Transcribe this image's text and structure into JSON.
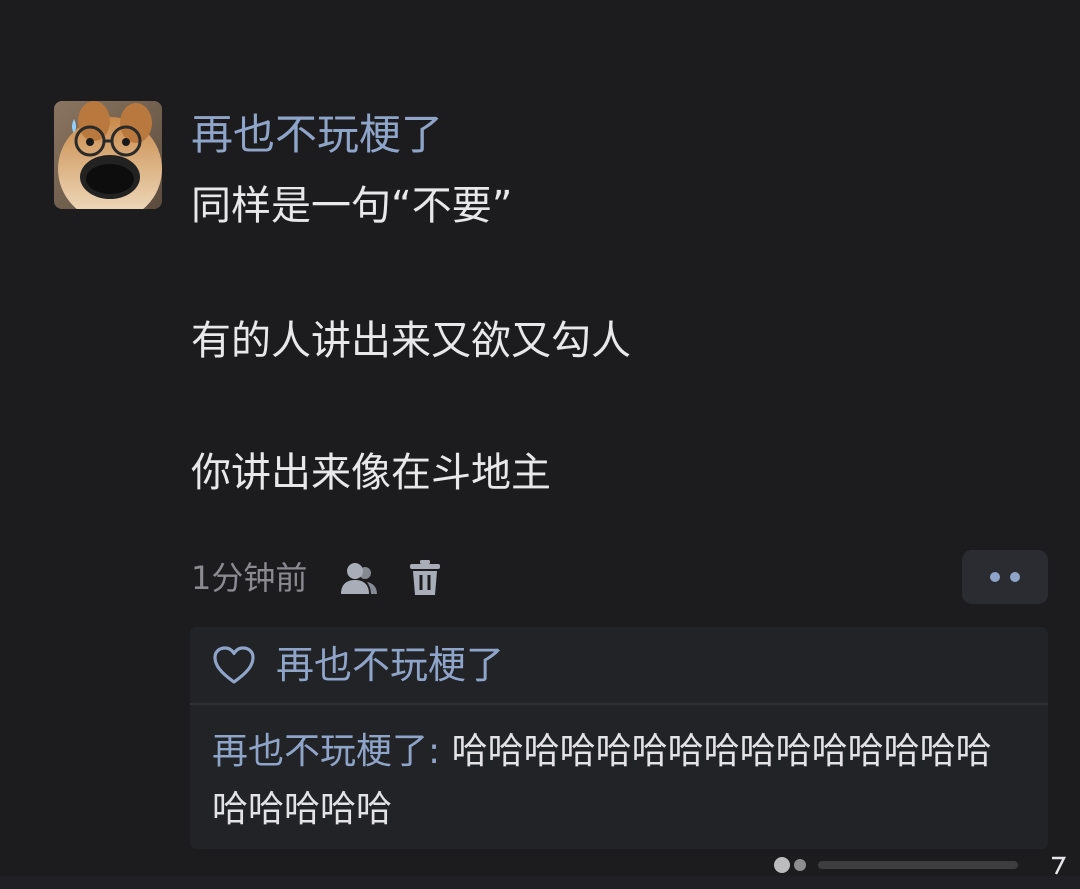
{
  "post": {
    "username": "再也不玩梗了",
    "lines": [
      "同样是一句“不要”",
      "有的人讲出来又欲又勾人",
      "你讲出来像在斗地主"
    ],
    "timestamp": "1分钟前",
    "icons": {
      "avatar": "dog-with-glasses-avatar",
      "profile": "person-icon",
      "delete": "trash-icon",
      "more": "more-dots-icon"
    }
  },
  "reply_panel": {
    "likes": {
      "icon": "heart-icon",
      "name": "再也不玩梗了"
    },
    "comment": {
      "author": "再也不玩梗了",
      "separator": ": ",
      "text": "哈哈哈哈哈哈哈哈哈哈哈哈哈哈哈哈哈哈哈哈"
    }
  },
  "colors": {
    "background": "#1c1c1e",
    "username": "#8ea4c8",
    "text": "#e8e8ea",
    "muted": "#8a8a90",
    "panel": "#222326"
  }
}
